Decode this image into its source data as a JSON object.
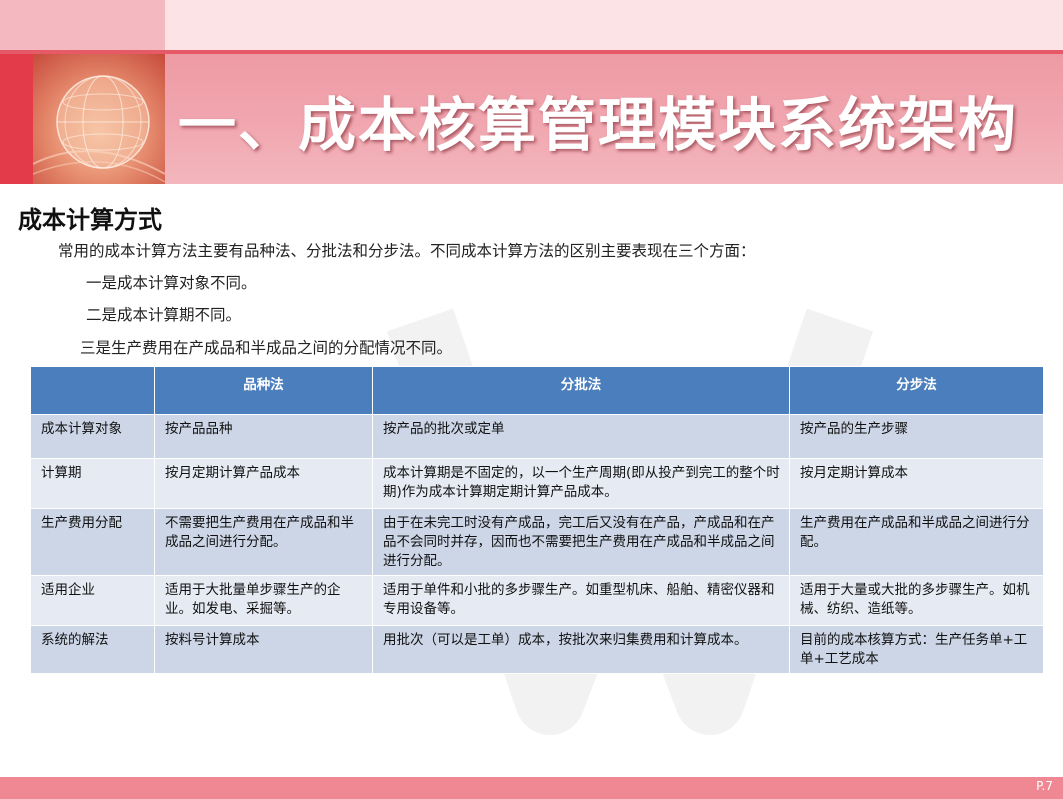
{
  "header": {
    "title": "一、成本核算管理模块系统架构"
  },
  "content": {
    "section_title": "成本计算方式",
    "intro": "常用的成本计算方法主要有品种法、分批法和分步法。不同成本计算方法的区别主要表现在三个方面：",
    "point1": "一是成本计算对象不同。",
    "point2": "二是成本计算期不同。",
    "point3": "三是生产费用在产成品和半成品之间的分配情况不同。"
  },
  "table": {
    "headers": [
      "",
      "品种法",
      "分批法",
      "分步法"
    ],
    "rows": [
      [
        "成本计算对象",
        "按产品品种",
        "按产品的批次或定单",
        "按产品的生产步骤"
      ],
      [
        "计算期",
        "按月定期计算产品成本",
        "成本计算期是不固定的，以一个生产周期(即从投产到完工的整个时期)作为成本计算期定期计算产品成本。",
        "按月定期计算成本"
      ],
      [
        "生产费用分配",
        "不需要把生产费用在产成品和半成品之间进行分配。",
        "由于在未完工时没有产成品，完工后又没有在产品，产成品和在产品不会同时并存，因而也不需要把生产费用在产成品和半成品之间进行分配。",
        "生产费用在产成品和半成品之间进行分配。"
      ],
      [
        "适用企业",
        "适用于大批量单步骤生产的企业。如发电、采掘等。",
        "适用于单件和小批的多步骤生产。如重型机床、船舶、精密仪器和专用设备等。",
        "适用于大量或大批的多步骤生产。如机械、纺织、造纸等。"
      ],
      [
        "系统的解法",
        "按料号计算成本",
        "用批次（可以是工单）成本，按批次来归集费用和计算成本。",
        "目前的成本核算方式：生产任务单+工单+工艺成本"
      ]
    ]
  },
  "footer": {
    "page_number": "P.7"
  },
  "colors": {
    "header_pink": "#f1a7b0",
    "accent_red": "#e33b49",
    "table_header_blue": "#4a7ebc",
    "row_dark": "#cdd6e7",
    "row_light": "#e6eaf3"
  }
}
